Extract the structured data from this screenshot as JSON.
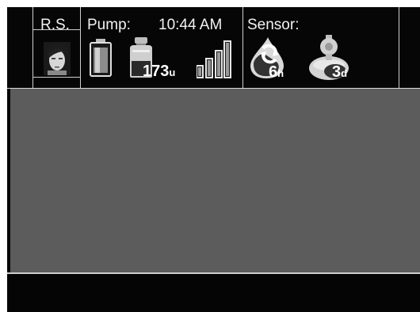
{
  "user": {
    "initials": "R.S."
  },
  "pump": {
    "label": "Pump:",
    "time": "10:44 AM",
    "insulin_units": "173",
    "insulin_unit_suffix": "u",
    "battery_level": 0.85,
    "signal_bars": 4,
    "signal_bars_filled": 4
  },
  "sensor": {
    "label": "Sensor:",
    "calibration_hours": "6",
    "calibration_suffix": "h",
    "sensor_days": "3",
    "sensor_suffix": "d"
  },
  "icons": {
    "avatar": "user-avatar-icon",
    "battery": "battery-icon",
    "reservoir": "insulin-reservoir-icon",
    "signal": "signal-strength-icon",
    "calibration": "calibration-drop-icon",
    "sensor_life": "sensor-life-icon"
  },
  "colors": {
    "background": "#060606",
    "graph": "#5c5c5c",
    "divider": "#cfcfcf",
    "text": "#f2f2f2"
  }
}
